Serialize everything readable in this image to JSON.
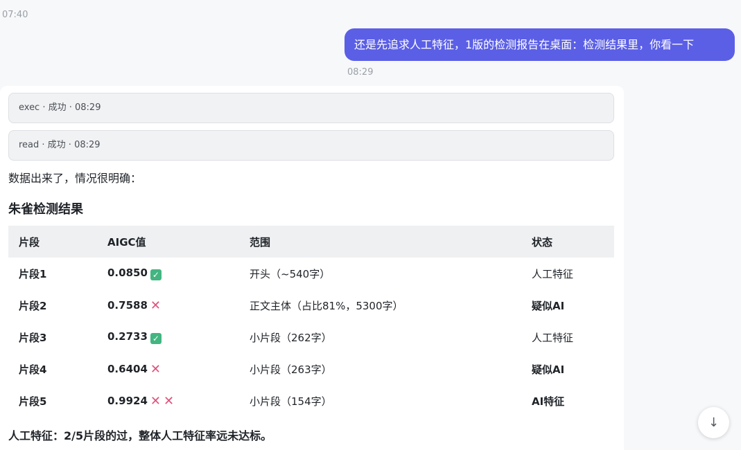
{
  "top_timestamp": "07:40",
  "user_message": {
    "text": "还是先追求人工特征，1版的检测报告在桌面：检测结果里，你看一下",
    "time": "08:29"
  },
  "tool_calls": [
    {
      "label": "exec · 成功 · 08:29"
    },
    {
      "label": "read · 成功 · 08:29"
    }
  ],
  "assistant": {
    "intro": "数据出来了，情况很明确：",
    "section_title": "朱雀检测结果",
    "table": {
      "headers": [
        "片段",
        "AIGC值",
        "范围",
        "状态"
      ],
      "rows": [
        {
          "segment": "片段1",
          "aigc": "0.0850",
          "marks": [
            "✓"
          ],
          "range": "开头（~540字）",
          "status": "人工特征",
          "status_bold": false
        },
        {
          "segment": "片段2",
          "aigc": "0.7588",
          "marks": [
            "✕"
          ],
          "range": "正文主体（占比81%，5300字）",
          "status": "疑似AI",
          "status_bold": true
        },
        {
          "segment": "片段3",
          "aigc": "0.2733",
          "marks": [
            "✓"
          ],
          "range": "小片段（262字）",
          "status": "人工特征",
          "status_bold": false
        },
        {
          "segment": "片段4",
          "aigc": "0.6404",
          "marks": [
            "✕"
          ],
          "range": "小片段（263字）",
          "status": "疑似AI",
          "status_bold": true
        },
        {
          "segment": "片段5",
          "aigc": "0.9924",
          "marks": [
            "✕",
            "✕"
          ],
          "range": "小片段（154字）",
          "status": "AI特征",
          "status_bold": true
        }
      ]
    },
    "summary": "人工特征：2/5片段的过，整体人工特征率远未达标。"
  },
  "scroll_button": {
    "icon": "arrow-down-icon",
    "glyph": "↓"
  },
  "colors": {
    "user_bubble": "#5b5fe6",
    "check": "#43b581",
    "cross": "#e0507a"
  }
}
